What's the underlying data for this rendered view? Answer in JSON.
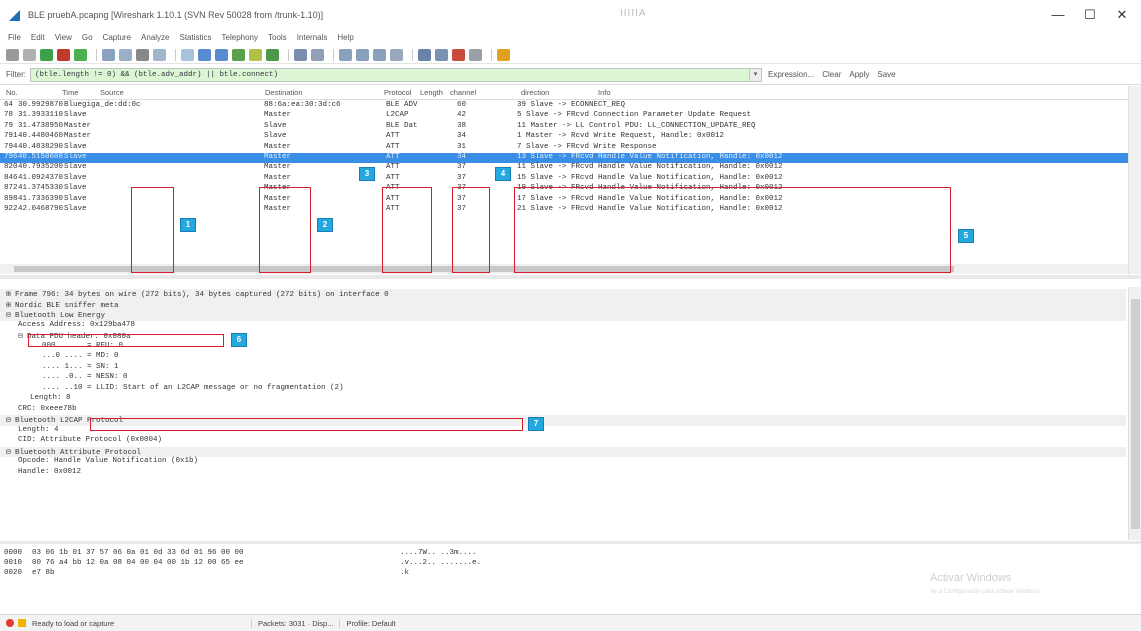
{
  "window": {
    "title": "BLE pruebA.pcapng [Wireshark 1.10.1 (SVN Rev 50028 from /trunk-1.10)]",
    "center_mark": "IIIIIA",
    "minimize": "—",
    "maximize": "☐",
    "close": "✕"
  },
  "menu": [
    "File",
    "Edit",
    "View",
    "Go",
    "Capture",
    "Analyze",
    "Statistics",
    "Telephony",
    "Tools",
    "Internals",
    "Help"
  ],
  "filter": {
    "label": "Filter:",
    "value": "(btle.length != 0) && (btle.adv_addr) || btle.connect)",
    "expression": "Expression...",
    "clear": "Clear",
    "apply": "Apply",
    "save": "Save"
  },
  "packet_list": {
    "columns": [
      "No.",
      "Time",
      "Source",
      "Destination",
      "Protocol",
      "Length",
      "channel",
      "direction",
      "Info"
    ],
    "rows": [
      {
        "no": "64",
        "time": "30.9929870",
        "src": "Bluegiga_de:dd:0c",
        "dst": "88:6a:ea:30:3d:c6",
        "proto": "BLE ADV",
        "len": "60",
        "info": "39 Slave -> ECONNECT_REQ"
      },
      {
        "no": "78",
        "time": "31.3933110",
        "src": "Slave",
        "dst": "Master",
        "proto": "L2CAP",
        "len": "42",
        "info": "5 Slave -> FRcvd Connection Parameter Update Request"
      },
      {
        "no": "79",
        "time": "31.4738950",
        "src": "Master",
        "dst": "Slave",
        "proto": "BLE Dat",
        "len": "38",
        "info": "11 Master -> LL Control PDU: LL_CONNECTION_UPDATE_REQ"
      },
      {
        "no": "791",
        "time": "40.4480460",
        "src": "Master",
        "dst": "Slave",
        "proto": "ATT",
        "len": "34",
        "info": "1 Master -> Rcvd Write Request, Handle: 0x0012"
      },
      {
        "no": "794",
        "time": "40.4838290",
        "src": "Slave",
        "dst": "Master",
        "proto": "ATT",
        "len": "31",
        "info": "7 Slave -> FRcvd Write Response"
      },
      {
        "no": "796",
        "time": "40.5150600",
        "src": "Slave",
        "dst": "Master",
        "proto": "ATT",
        "len": "34",
        "info": "13 Slave -> FRcvd Handle Value Notification, Handle: 0x0012"
      },
      {
        "no": "820",
        "time": "40.7935200",
        "src": "Slave",
        "dst": "Master",
        "proto": "ATT",
        "len": "37",
        "info": "11 Slave -> FRcvd Handle Value Notification, Handle: 0x0012"
      },
      {
        "no": "846",
        "time": "41.0924370",
        "src": "Slave",
        "dst": "Master",
        "proto": "ATT",
        "len": "37",
        "info": "15 Slave -> FRcvd Handle Value Notification, Handle: 0x0012"
      },
      {
        "no": "872",
        "time": "41.3745330",
        "src": "Slave",
        "dst": "Master",
        "proto": "ATT",
        "len": "37",
        "info": "19 Slave -> FRcvd Handle Value Notification, Handle: 0x0012"
      },
      {
        "no": "898",
        "time": "41.7336390",
        "src": "Slave",
        "dst": "Master",
        "proto": "ATT",
        "len": "37",
        "info": "17 Slave -> FRcvd Handle Value Notification, Handle: 0x0012"
      },
      {
        "no": "922",
        "time": "42.0468790",
        "src": "Slave",
        "dst": "Master",
        "proto": "ATT",
        "len": "37",
        "info": "21 Slave -> FRcvd Handle Value Notification, Handle: 0x0012"
      }
    ],
    "selected_row": 5
  },
  "badges": {
    "b1": "1",
    "b2": "2",
    "b3": "3",
    "b4": "4",
    "b5": "5",
    "b6": "6",
    "b7": "7"
  },
  "details": [
    {
      "text": "⊞ Frame 796: 34 bytes on wire (272 bits), 34 bytes captured (272 bits) on interface 0",
      "indent": 0,
      "shade": true
    },
    {
      "text": "⊞ Nordic BLE sniffer meta",
      "indent": 0,
      "shade": true
    },
    {
      "text": "⊟ Bluetooth Low Energy",
      "indent": 0,
      "shade": true
    },
    {
      "text": "Access Address: 0x129ba478",
      "indent": 1,
      "shade": false
    },
    {
      "text": "⊟ Data PDU header: 0x080a",
      "indent": 1,
      "shade": false
    },
    {
      "text": "000. .... = RFU: 0",
      "indent": 3,
      "shade": false
    },
    {
      "text": "...0 .... = MD: 0",
      "indent": 3,
      "shade": false
    },
    {
      "text": ".... 1... = SN: 1",
      "indent": 3,
      "shade": false
    },
    {
      "text": ".... .0.. = NESN: 0",
      "indent": 3,
      "shade": false
    },
    {
      "text": ".... ..10 = LLID: Start of an L2CAP message or no fragmentation (2)",
      "indent": 3,
      "shade": false
    },
    {
      "text": "Length: 8",
      "indent": 2,
      "shade": false
    },
    {
      "text": "CRC: 0xeee78b",
      "indent": 1,
      "shade": false
    },
    {
      "text": "⊟ Bluetooth L2CAP Protocol",
      "indent": 0,
      "shade": true
    },
    {
      "text": "Length: 4",
      "indent": 1,
      "shade": false
    },
    {
      "text": "CID: Attribute Protocol (0x0004)",
      "indent": 1,
      "shade": false
    },
    {
      "text": "⊟ Bluetooth Attribute Protocol",
      "indent": 0,
      "shade": true
    },
    {
      "text": "Opcode: Handle Value Notification (0x1b)",
      "indent": 1,
      "shade": false
    },
    {
      "text": "Handle: 0x0012",
      "indent": 1,
      "shade": false
    }
  ],
  "hex": [
    {
      "off": "0000",
      "bytes": "03 06 1b 01 37 57 06 0a  01 0d 33 6d 01 96 00 00",
      "ascii": "....7W.. ..3m...."
    },
    {
      "off": "0010",
      "bytes": "00 76 a4 bb 12 0a 08 04  00 04 00 1b 12 00 65 ee",
      "ascii": ".v...2.. .......e."
    },
    {
      "off": "0020",
      "bytes": "e7 8b",
      "ascii": ".k"
    }
  ],
  "watermark": {
    "line1": "Activar Windows",
    "line2": "Ve a Configuración para activar Windows"
  },
  "status": {
    "ready": "Ready to load or capture",
    "packets": "Packets: 3031 · Disp...",
    "profile": "Profile: Default"
  },
  "colors": {
    "selected": "#3a8ee6",
    "highlight": "#d81e2e",
    "badge": "#23a8e0",
    "filter_ok": "#dcf5d2"
  }
}
